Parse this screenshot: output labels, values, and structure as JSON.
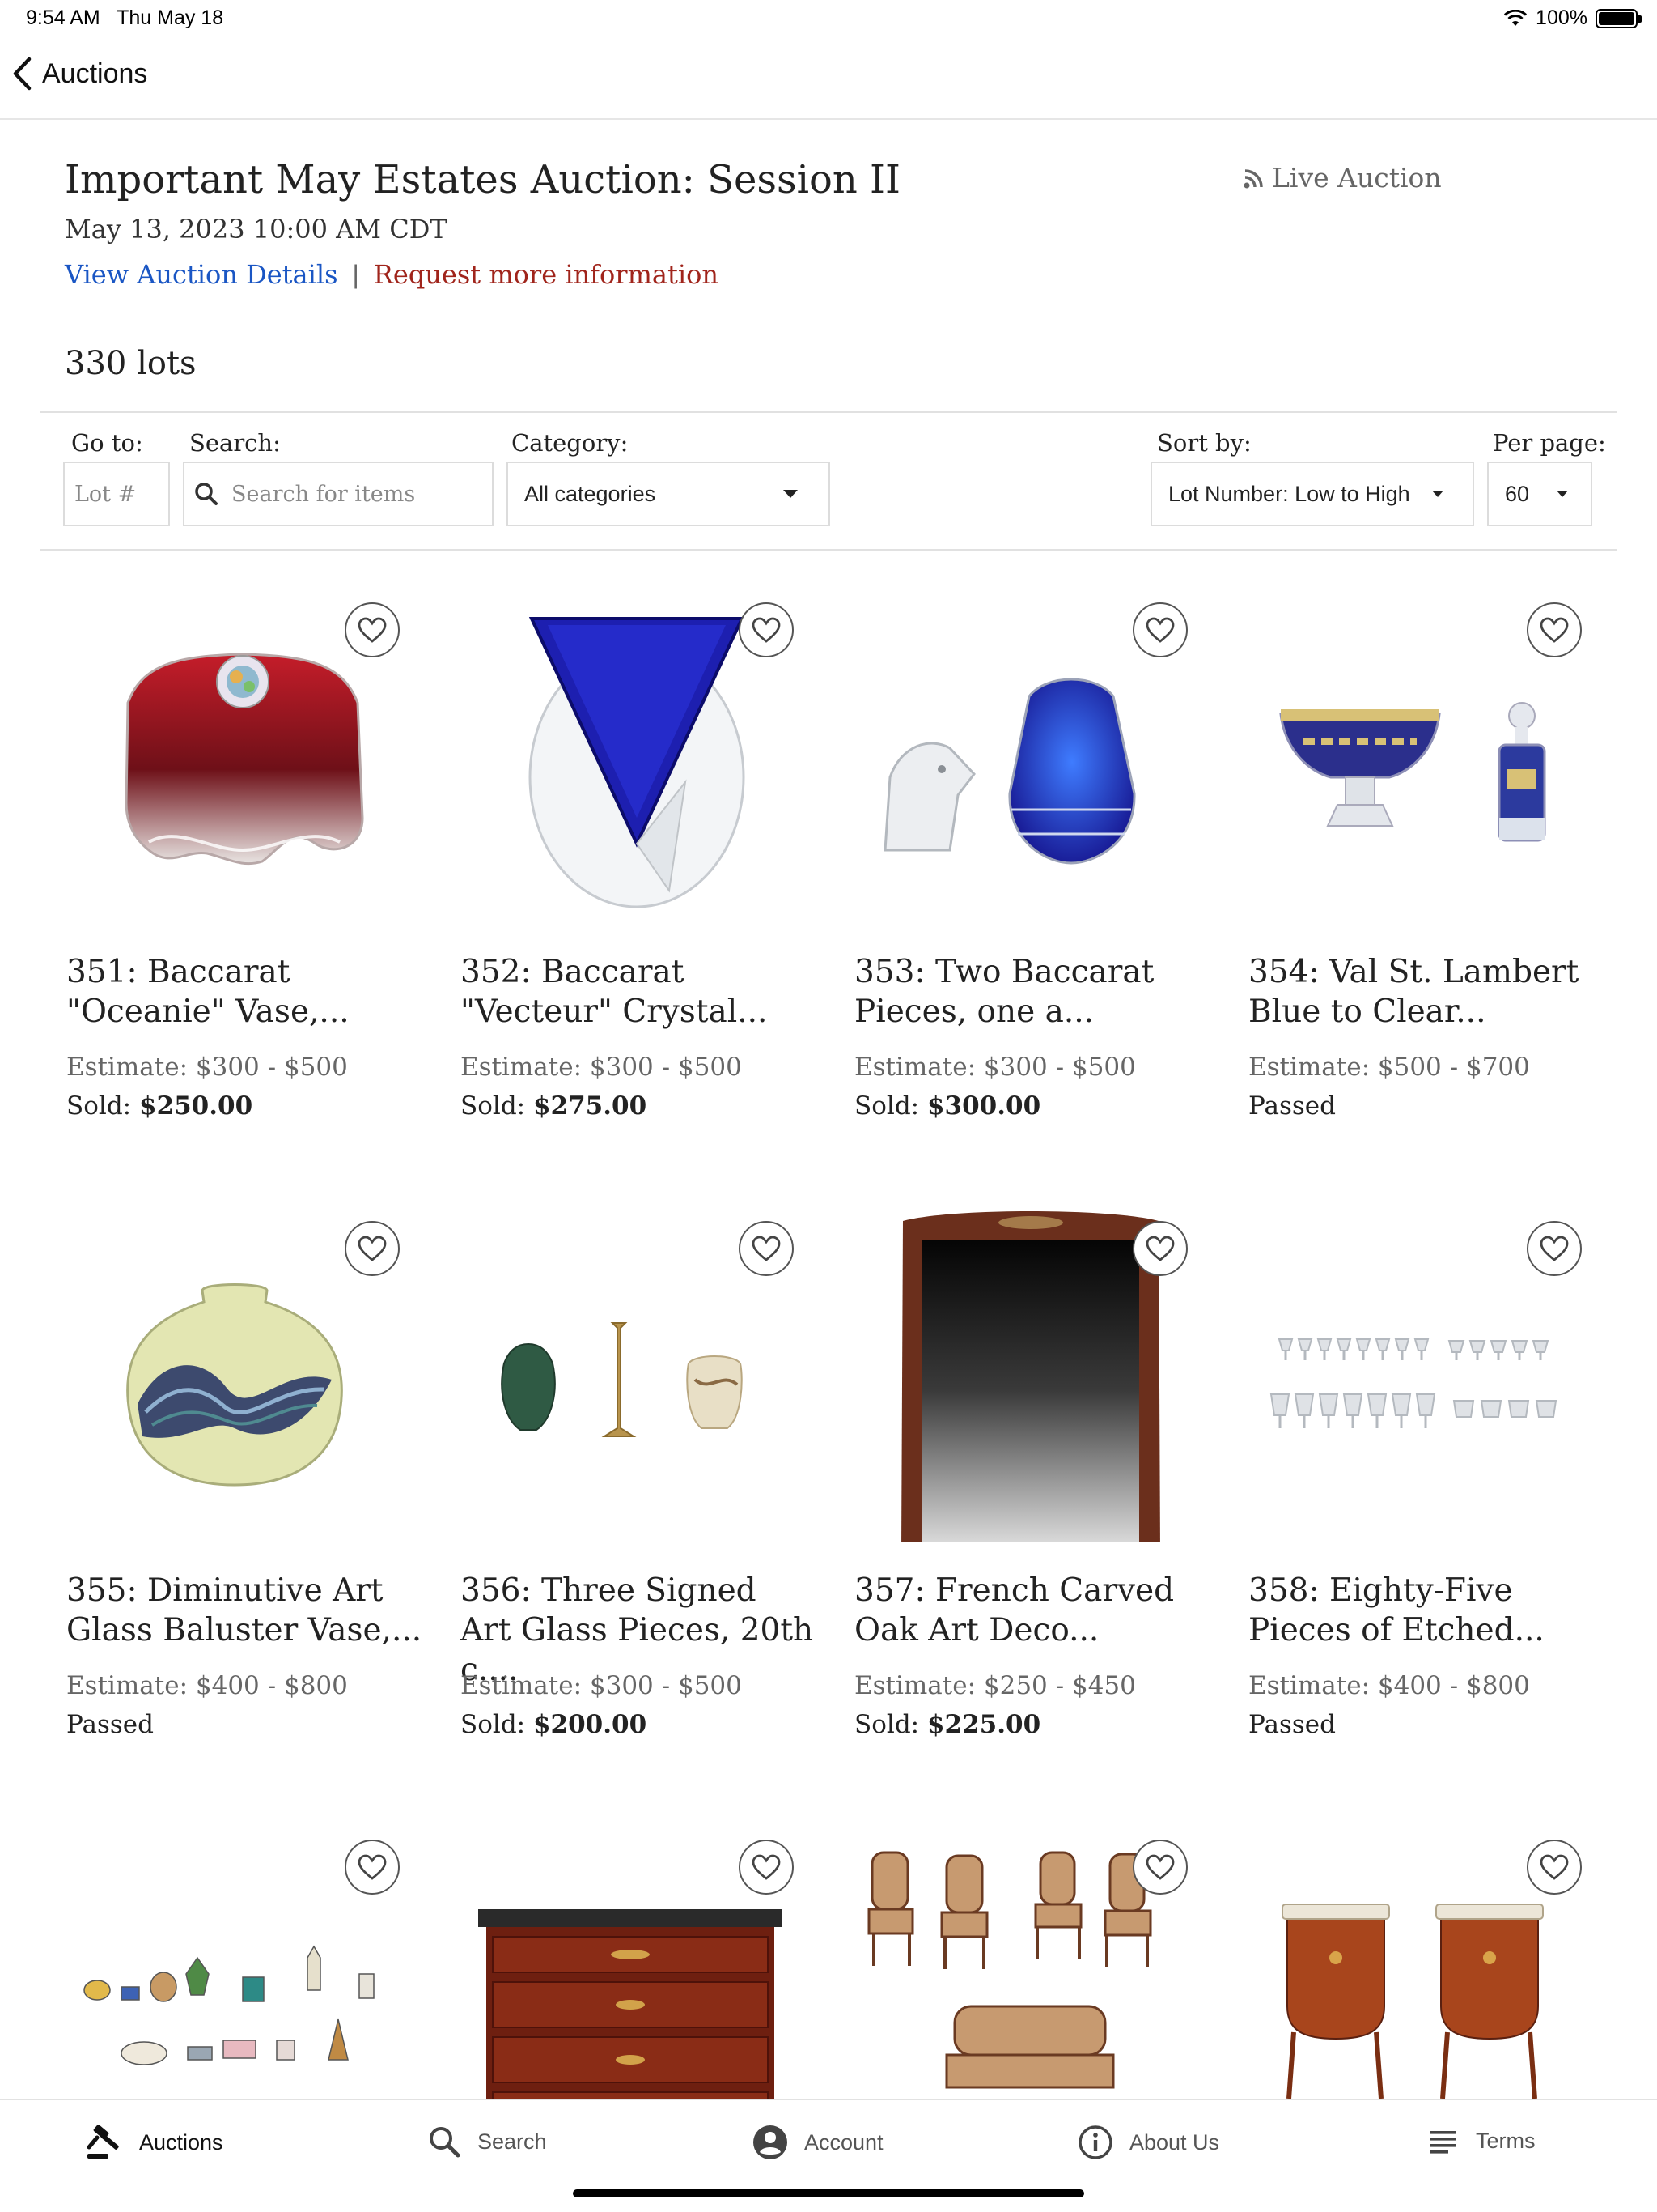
{
  "status_bar": {
    "time_date": "9:54 AM   Thu May 18",
    "battery": "100%"
  },
  "nav": {
    "back_label": "Auctions"
  },
  "auction": {
    "title": "Important May Estates Auction: Session II",
    "date": "May 13, 2023 10:00 AM CDT",
    "view_details": "View Auction Details",
    "separator": "|",
    "request_info": "Request more information",
    "live_auction": "Live Auction",
    "lot_count": "330 lots"
  },
  "filters": {
    "goto_label": "Go to:",
    "goto_placeholder": "Lot #",
    "search_label": "Search:",
    "search_placeholder": "Search for items",
    "category_label": "Category:",
    "category_value": "All categories",
    "sort_label": "Sort by:",
    "sort_value": "Lot Number: Low to High",
    "perpage_label": "Per page:",
    "perpage_value": "60"
  },
  "lots": [
    {
      "title": "351: Baccarat \"Oceanie\" Vase,...",
      "estimate": "Estimate: $300 - $500",
      "status": "Sold:",
      "price": "$250.00"
    },
    {
      "title": "352: Baccarat \"Vecteur\" Crystal...",
      "estimate": "Estimate: $300 - $500",
      "status": "Sold:",
      "price": "$275.00"
    },
    {
      "title": "353: Two Baccarat Pieces, one a...",
      "estimate": "Estimate: $300 - $500",
      "status": "Sold:",
      "price": "$300.00"
    },
    {
      "title": "354: Val St. Lambert Blue to Clear...",
      "estimate": "Estimate: $500 - $700",
      "status": "Passed",
      "price": ""
    },
    {
      "title": "355: Diminutive Art Glass Baluster Vase,...",
      "estimate": "Estimate: $400 - $800",
      "status": "Passed",
      "price": ""
    },
    {
      "title": "356: Three Signed Art Glass Pieces, 20th c....",
      "estimate": "Estimate: $300 - $500",
      "status": "Sold:",
      "price": "$200.00"
    },
    {
      "title": "357: French Carved Oak Art Deco...",
      "estimate": "Estimate: $250 - $450",
      "status": "Sold:",
      "price": "$225.00"
    },
    {
      "title": "358: Eighty-Five Pieces of Etched...",
      "estimate": "Estimate: $400 - $800",
      "status": "Passed",
      "price": ""
    }
  ],
  "tabs": [
    {
      "label": "Auctions"
    },
    {
      "label": "Search"
    },
    {
      "label": "Account"
    },
    {
      "label": "About Us"
    },
    {
      "label": "Terms"
    }
  ],
  "colors": {
    "link_blue": "#1a56c4",
    "link_red": "#a0241b",
    "cobalt": "#1c2bb8",
    "ruby": "#9a1a22"
  }
}
